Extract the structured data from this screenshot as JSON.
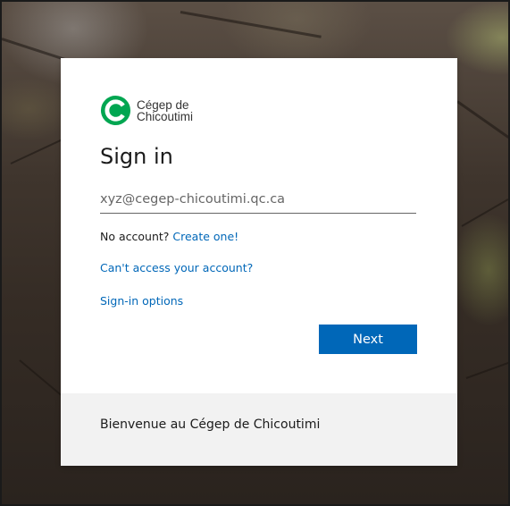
{
  "org": {
    "name_line1": "Cégep de",
    "name_line2": "Chicoutimi",
    "logo_color": "#00a651"
  },
  "signin": {
    "title": "Sign in",
    "email_placeholder": "xyz@cegep-chicoutimi.qc.ca",
    "no_account_text": "No account?",
    "create_link": "Create one!",
    "cant_access_link": "Can't access your account?",
    "options_link": "Sign-in options",
    "next_label": "Next"
  },
  "footer": {
    "text": "Bienvenue au Cégep de Chicoutimi"
  },
  "colors": {
    "accent": "#0067b8",
    "footer_bg": "#f2f2f2"
  }
}
